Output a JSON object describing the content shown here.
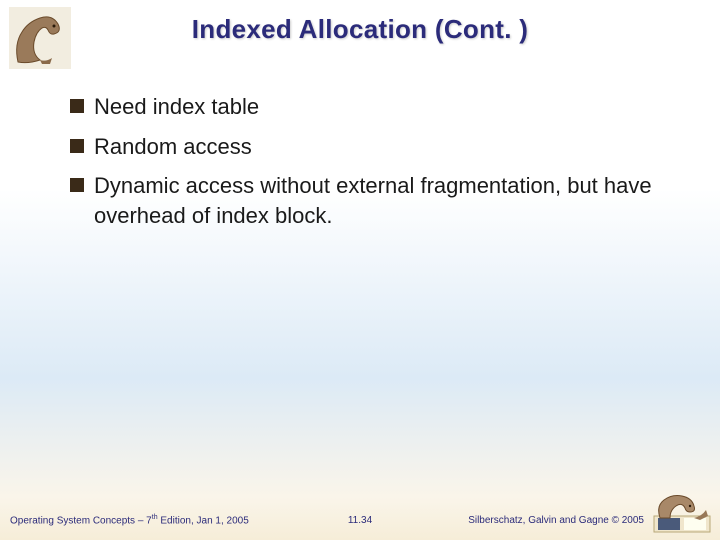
{
  "title": "Indexed Allocation (Cont. )",
  "bullets": [
    "Need index table",
    "Random access",
    "Dynamic access without external fragmentation, but have overhead of index block."
  ],
  "footer": {
    "left_prefix": "Operating System Concepts – 7",
    "left_sup": "th",
    "left_suffix": " Edition, Jan 1, 2005",
    "center": "11.34",
    "right": "Silberschatz, Galvin and Gagne © 2005"
  },
  "logos": {
    "top_alt": "dinosaur-logo",
    "bottom_alt": "dinosaur-book-logo"
  }
}
